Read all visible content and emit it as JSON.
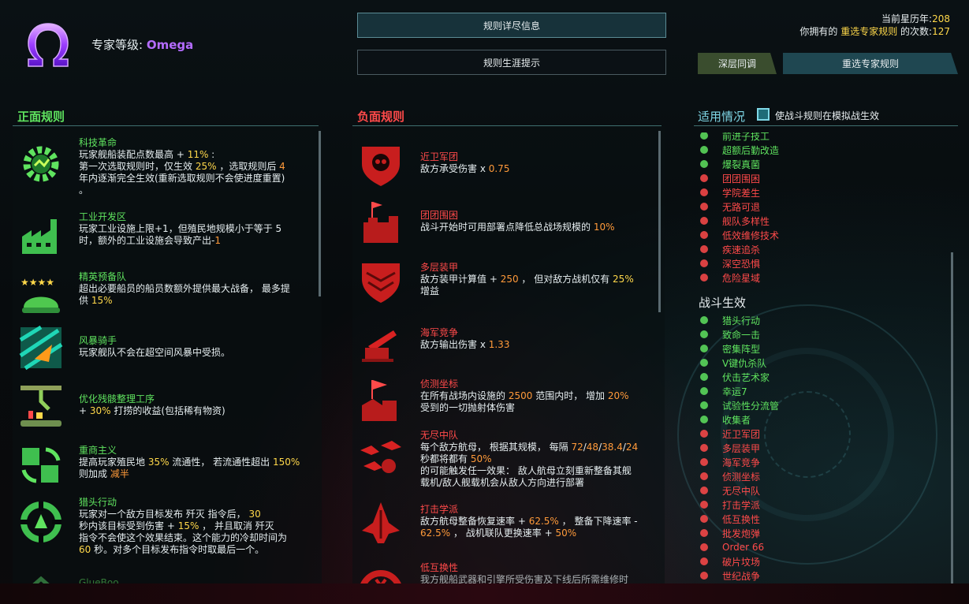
{
  "header": {
    "expert_prefix": "专家等级:",
    "expert_level": "Omega",
    "btn_details": "规则详尽信息",
    "btn_tips": "规则生涯提示",
    "year_label": "当前星历年:",
    "year_value": "208",
    "own_prefix": "你拥有的",
    "own_highlight": "重选专家规则",
    "own_suffix": "的次数:",
    "own_count": "127",
    "tab_deep": "深层同调",
    "tab_reselect": "重选专家规则"
  },
  "positive": {
    "title": "正面规则",
    "rules": [
      {
        "name": "科技革命",
        "d1": "玩家舰船装配点数最高 + ",
        "v1": "11%",
        "d2": " :",
        "d3": "第一次选取规则时，仅生效 ",
        "v2": "25%",
        "d4": " ，选取规则后 ",
        "v3": "4",
        "d5": "年内逐渐完全生效(重新选取规则不会使进度重置)",
        "d6": "。",
        "icon": "gear-icon"
      },
      {
        "name": "工业开发区",
        "d1": "玩家工业设施上限+1，但殖民地规模小于等于 5",
        "d2": "时，额外的工业设施会导致产出-",
        "v1": "1",
        "icon": "factory-icon"
      },
      {
        "name": "精英预备队",
        "d1": "超出必要船员的船员数额外提供最大战备， 最多提",
        "d2": "供 ",
        "v1": "15%",
        "icon": "helmet-stars-icon"
      },
      {
        "name": "风暴骑手",
        "d1": "玩家舰队不会在超空间风暴中受损。",
        "icon": "storm-ship-icon"
      },
      {
        "name": "优化残骸整理工序",
        "d1": "+ ",
        "v1": "30%",
        "d2": " 打捞的收益(包括稀有物资)",
        "icon": "robot-arm-icon"
      },
      {
        "name": "重商主义",
        "d1": "提高玩家殖民地 ",
        "v1": "35%",
        "d2": " 流通性， 若流通性超出 ",
        "v2": "150%",
        "d3": "则加成 ",
        "v3": "减半",
        "icon": "trade-icon"
      },
      {
        "name": "猎头行动",
        "d1": "玩家对一个敌方目标发布 歼灭 指令后， ",
        "v1": "30",
        "d2": "秒内该目标受到伤害 + ",
        "v2": "15%",
        "d3": " ， 并且取消 歼灭",
        "d4": "指令不会使这个效果结束。这个能力的冷却时间为",
        "v3": "60",
        "d5": " 秒。对多个目标发布指令时取最后一个。",
        "icon": "crosshair-icon"
      },
      {
        "name": "GlueBoo",
        "icon": "partial-icon"
      }
    ]
  },
  "negative": {
    "title": "负面规则",
    "rules": [
      {
        "name": "近卫军团",
        "d1": "敌方承受伤害 x ",
        "v1": "0.75",
        "icon": "skull-shield-icon"
      },
      {
        "name": "团团围困",
        "d1": "战斗开始时可用部署点降低总战场规模的 ",
        "v1": "10%",
        "icon": "castle-icon"
      },
      {
        "name": "多层装甲",
        "d1": "敌方装甲计算值 + ",
        "v1": "250",
        "d2": " ， 但对敌方战机仅有 ",
        "v2": "25%",
        "d3": "增益",
        "icon": "armor-shield-icon"
      },
      {
        "name": "海军竞争",
        "d1": "敌方输出伤害 x ",
        "v1": "1.33",
        "icon": "cannon-icon"
      },
      {
        "name": "侦测坐标",
        "d1": "在所有战场内设施的 ",
        "v1": "2500",
        "d2": " 范围内时， 增加 ",
        "v2": "20%",
        "d3": "受到的一切抛射体伤害",
        "icon": "flag-base-icon"
      },
      {
        "name": "无尽中队",
        "d1": "每个敌方航母， 根据其规模， 每隔 ",
        "v1": "72",
        "s1": "/",
        "v2": "48",
        "s2": "/",
        "v3": "38.4",
        "s3": "/",
        "v4": "24",
        "d2": "秒都将都有 ",
        "v5": "50%",
        "d3": "的可能触发任一效果： 敌人航母立刻重新整备其舰",
        "d4": "载机/敌人舰载机会从敌人方向进行部署",
        "icon": "fighters-icon"
      },
      {
        "name": "打击学派",
        "d1": "敌方航母整备恢复速率 + ",
        "v1": "62.5%",
        "d2": " ， 整备下降速率 - ",
        "v2": "62.5%",
        "d3": " ， 战机联队更换速率 + ",
        "v3": "50%",
        "icon": "strike-ship-icon"
      },
      {
        "name": "低互换性",
        "d1": "我方舰船武器和引擎所受伤害及下线后所需维修时",
        "icon": "gauge-icon"
      }
    ]
  },
  "applicable": {
    "title": "适用情况",
    "checkbox_label": "使战斗规则在模拟战生效",
    "top_items": [
      {
        "name": "前进子技工",
        "color": "g",
        "icon": "worker-icon"
      },
      {
        "name": "超额后勤改造",
        "color": "g",
        "icon": "supply-icon"
      },
      {
        "name": "爆裂真菌",
        "color": "g",
        "icon": "fungus-icon"
      },
      {
        "name": "团团围困",
        "color": "r",
        "icon": "castle-icon"
      },
      {
        "name": "学院差生",
        "color": "r",
        "icon": "student-icon"
      },
      {
        "name": "无路可退",
        "color": "r",
        "icon": "no-retreat-icon"
      },
      {
        "name": "舰队多样性",
        "color": "r",
        "icon": "diversity-icon"
      },
      {
        "name": "低效维修技术",
        "color": "r",
        "icon": "repair-icon"
      },
      {
        "name": "疾速追杀",
        "color": "r",
        "icon": "chase-icon"
      },
      {
        "name": "深空恐惧",
        "color": "r",
        "icon": "fear-icon"
      },
      {
        "name": "危险星域",
        "color": "r",
        "icon": "danger-icon"
      }
    ],
    "combat_title": "战斗生效",
    "combat_items": [
      {
        "name": "猎头行动",
        "color": "g",
        "icon": "crosshair-icon"
      },
      {
        "name": "致命一击",
        "color": "g",
        "icon": "critical-icon"
      },
      {
        "name": "密集阵型",
        "color": "g",
        "icon": "formation-icon"
      },
      {
        "name": "V键仇杀队",
        "color": "g",
        "icon": "v-squad-icon"
      },
      {
        "name": "伏击艺术家",
        "color": "g",
        "icon": "ambush-icon"
      },
      {
        "name": "幸运7",
        "color": "g",
        "icon": "lucky-icon"
      },
      {
        "name": "试验性分流管",
        "color": "g",
        "icon": "tube-icon"
      },
      {
        "name": "收集者",
        "color": "g",
        "icon": "collector-icon"
      },
      {
        "name": "近卫军团",
        "color": "r",
        "icon": "skull-shield-icon"
      },
      {
        "name": "多层装甲",
        "color": "r",
        "icon": "armor-shield-icon"
      },
      {
        "name": "海军竞争",
        "color": "r",
        "icon": "cannon-icon"
      },
      {
        "name": "侦测坐标",
        "color": "r",
        "icon": "flag-base-icon"
      },
      {
        "name": "无尽中队",
        "color": "r",
        "icon": "fighters-icon"
      },
      {
        "name": "打击学派",
        "color": "r",
        "icon": "strike-ship-icon"
      },
      {
        "name": "低互换性",
        "color": "r",
        "icon": "gauge-icon"
      },
      {
        "name": "批发炮弹",
        "color": "r",
        "icon": "shells-icon"
      },
      {
        "name": "Order 66",
        "color": "r",
        "icon": "order-icon"
      },
      {
        "name": "破片坟场",
        "color": "r",
        "icon": "debris-icon"
      },
      {
        "name": "世纪战争",
        "color": "r",
        "icon": "war-icon"
      }
    ]
  },
  "colors": {
    "positive": "#5fe35f",
    "negative": "#ff4a4a",
    "highlight": "#ffd84a",
    "accent": "#7fd7e6",
    "omega": "#b46cff"
  }
}
